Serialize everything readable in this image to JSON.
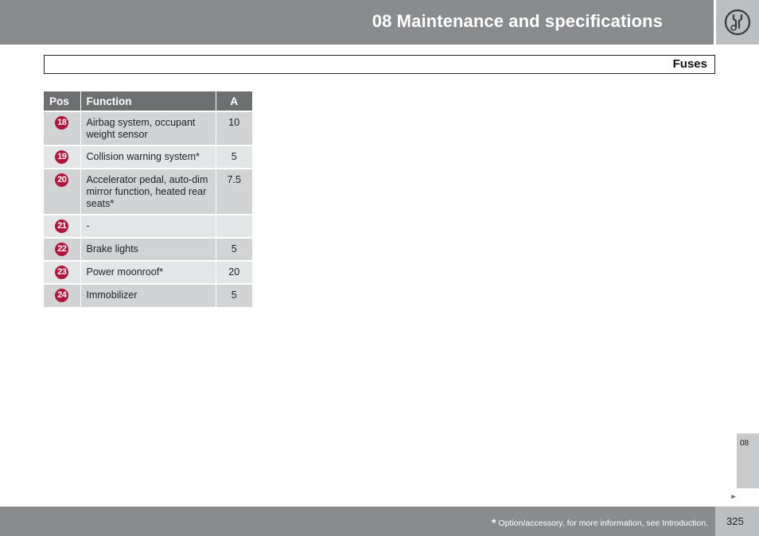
{
  "header": {
    "title": "08 Maintenance and specifications",
    "icon": "wrench-gear-icon"
  },
  "section": {
    "title": "Fuses"
  },
  "table": {
    "columns": [
      "Pos",
      "Function",
      "A"
    ],
    "rows": [
      {
        "pos": "18",
        "function": "Airbag system, occupant weight sensor",
        "amps": "10"
      },
      {
        "pos": "19",
        "function": "Collision warning system*",
        "amps": "5"
      },
      {
        "pos": "20",
        "function": "Accelerator pedal, auto-dim mirror function, heated rear seats*",
        "amps": "7.5"
      },
      {
        "pos": "21",
        "function": "-",
        "amps": ""
      },
      {
        "pos": "22",
        "function": "Brake lights",
        "amps": "5"
      },
      {
        "pos": "23",
        "function": "Power moonroof*",
        "amps": "20"
      },
      {
        "pos": "24",
        "function": "Immobilizer",
        "amps": "5"
      }
    ],
    "badge_color": "#b3143c"
  },
  "chapter_tab": {
    "label": "08",
    "arrows": "▸▸"
  },
  "footer": {
    "star": "*",
    "note": "Option/accessory, for more information, see Introduction.",
    "page_number": "325"
  }
}
